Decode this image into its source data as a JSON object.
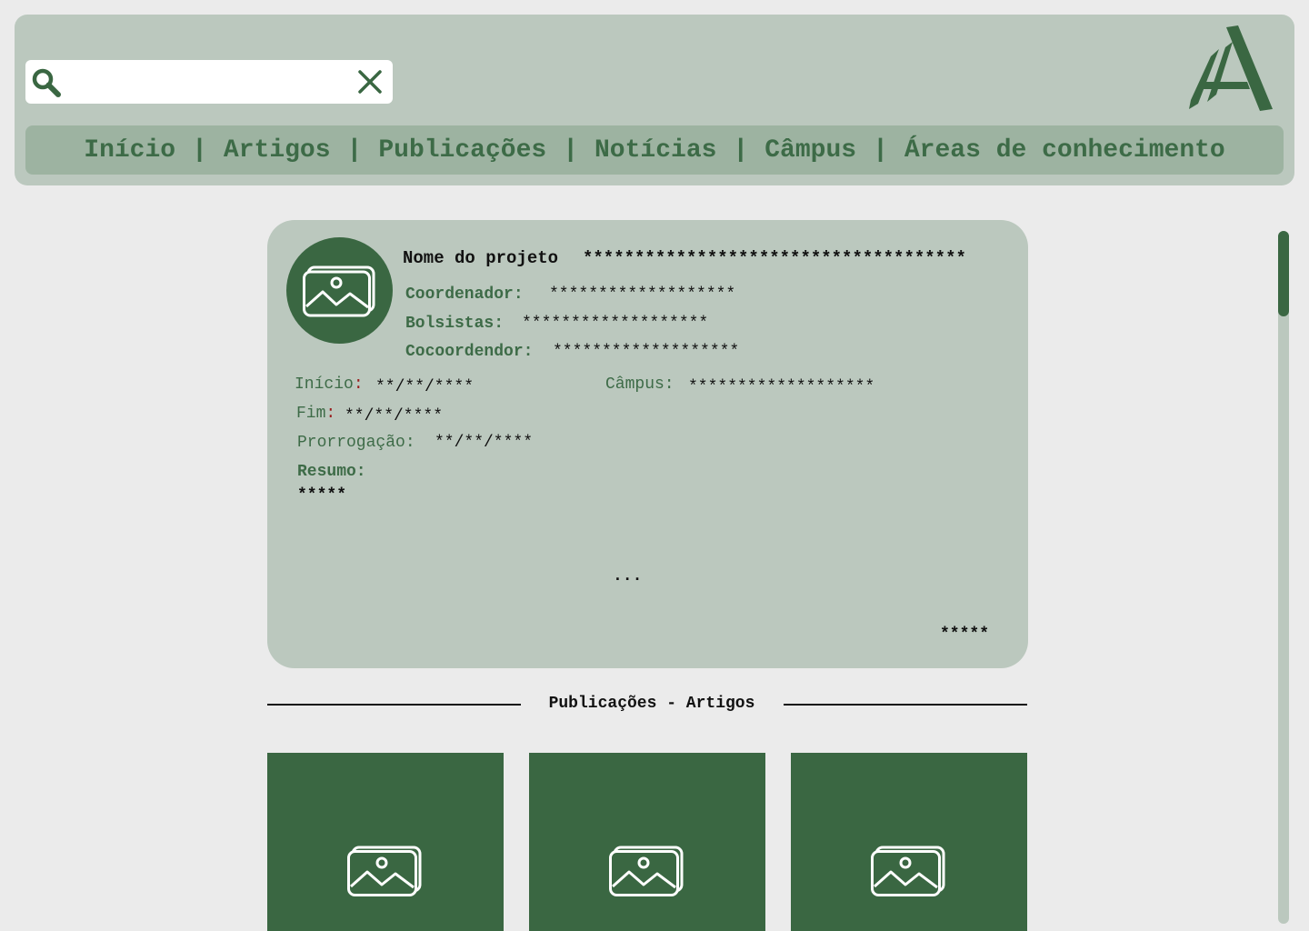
{
  "search": {
    "value": "",
    "placeholder": ""
  },
  "nav": {
    "items": [
      {
        "label": "Início"
      },
      {
        "label": "Artigos"
      },
      {
        "label": "Publicações"
      },
      {
        "label": "Notícias"
      },
      {
        "label": "Câmpus"
      },
      {
        "label": "Áreas de conhecimento"
      }
    ],
    "separator": "|"
  },
  "project": {
    "name_label": "Nome do projeto",
    "name_value": "*************************************",
    "coordinator_label": "Coordenador:",
    "coordinator_value": "*******************",
    "scholars_label": "Bolsistas:",
    "scholars_value": "*******************",
    "cocoordinator_label": "Cocoordendor:",
    "cocoordinator_value": "*******************",
    "start_label": "Início",
    "start_value": "**/**/****",
    "end_label": "Fim",
    "end_value": "**/**/****",
    "colon": ":",
    "extension_label": "Prorrogação:",
    "extension_value": "**/**/****",
    "campus_label": "Câmpus:",
    "campus_value": "*******************",
    "summary_label": "Resumo:",
    "summary_value": "*****",
    "ellipsis": "...",
    "footer_value": "*****"
  },
  "section": {
    "title": "Publicações - Artigos"
  },
  "colors": {
    "primary": "#3a6742",
    "panel": "#bbc8be",
    "nav_bar": "#9db3a1",
    "background": "#ebebeb",
    "required_marker": "#9a1c1c"
  },
  "icons": {
    "search": "search-icon",
    "clear": "close-icon",
    "logo": "logo-a-pen-icon",
    "image_placeholder": "image-placeholder-icon"
  },
  "scrollbar": {
    "position_fraction": 0.0
  }
}
